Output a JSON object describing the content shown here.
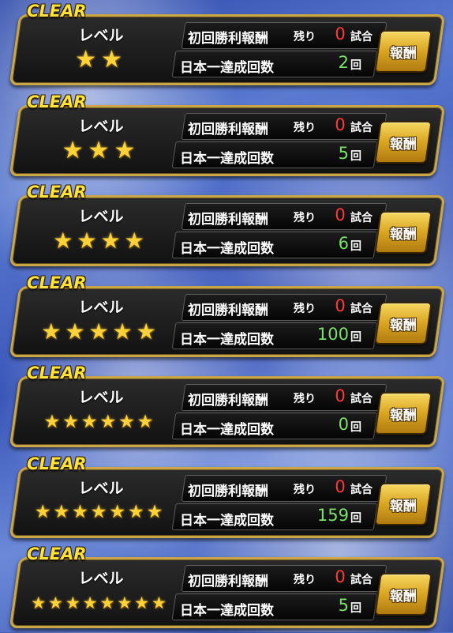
{
  "cards": [
    {
      "clear": "CLEAR",
      "level_label": "レベル",
      "stars": 2,
      "first_reward_label": "初回勝利報酬",
      "remaining_label": "残り",
      "remaining_count": "0",
      "remaining_unit": "試合",
      "champion_label": "日本一達成回数",
      "champion_count": "2",
      "champion_unit": "回",
      "reward_button": "報酬"
    },
    {
      "clear": "CLEAR",
      "level_label": "レベル",
      "stars": 3,
      "first_reward_label": "初回勝利報酬",
      "remaining_label": "残り",
      "remaining_count": "0",
      "remaining_unit": "試合",
      "champion_label": "日本一達成回数",
      "champion_count": "5",
      "champion_unit": "回",
      "reward_button": "報酬"
    },
    {
      "clear": "CLEAR",
      "level_label": "レベル",
      "stars": 4,
      "first_reward_label": "初回勝利報酬",
      "remaining_label": "残り",
      "remaining_count": "0",
      "remaining_unit": "試合",
      "champion_label": "日本一達成回数",
      "champion_count": "6",
      "champion_unit": "回",
      "reward_button": "報酬"
    },
    {
      "clear": "CLEAR",
      "level_label": "レベル",
      "stars": 5,
      "first_reward_label": "初回勝利報酬",
      "remaining_label": "残り",
      "remaining_count": "0",
      "remaining_unit": "試合",
      "champion_label": "日本一達成回数",
      "champion_count": "100",
      "champion_unit": "回",
      "reward_button": "報酬"
    },
    {
      "clear": "CLEAR",
      "level_label": "レベル",
      "stars": 6,
      "first_reward_label": "初回勝利報酬",
      "remaining_label": "残り",
      "remaining_count": "0",
      "remaining_unit": "試合",
      "champion_label": "日本一達成回数",
      "champion_count": "0",
      "champion_unit": "回",
      "reward_button": "報酬"
    },
    {
      "clear": "CLEAR",
      "level_label": "レベル",
      "stars": 7,
      "first_reward_label": "初回勝利報酬",
      "remaining_label": "残り",
      "remaining_count": "0",
      "remaining_unit": "試合",
      "champion_label": "日本一達成回数",
      "champion_count": "159",
      "champion_unit": "回",
      "reward_button": "報酬"
    },
    {
      "clear": "CLEAR",
      "level_label": "レベル",
      "stars": 8,
      "first_reward_label": "初回勝利報酬",
      "remaining_label": "残り",
      "remaining_count": "0",
      "remaining_unit": "試合",
      "champion_label": "日本一達成回数",
      "champion_count": "5",
      "champion_unit": "回",
      "reward_button": "報酬"
    }
  ],
  "colors": {
    "clear_text": "#ffe23a",
    "panel_border": "#c9a646",
    "remaining_count": "#ff3a3a",
    "champion_count": "#7be06a",
    "star": "#ffd23a",
    "reward_button": "#d9a521"
  },
  "icons": {
    "star": "star-icon"
  }
}
